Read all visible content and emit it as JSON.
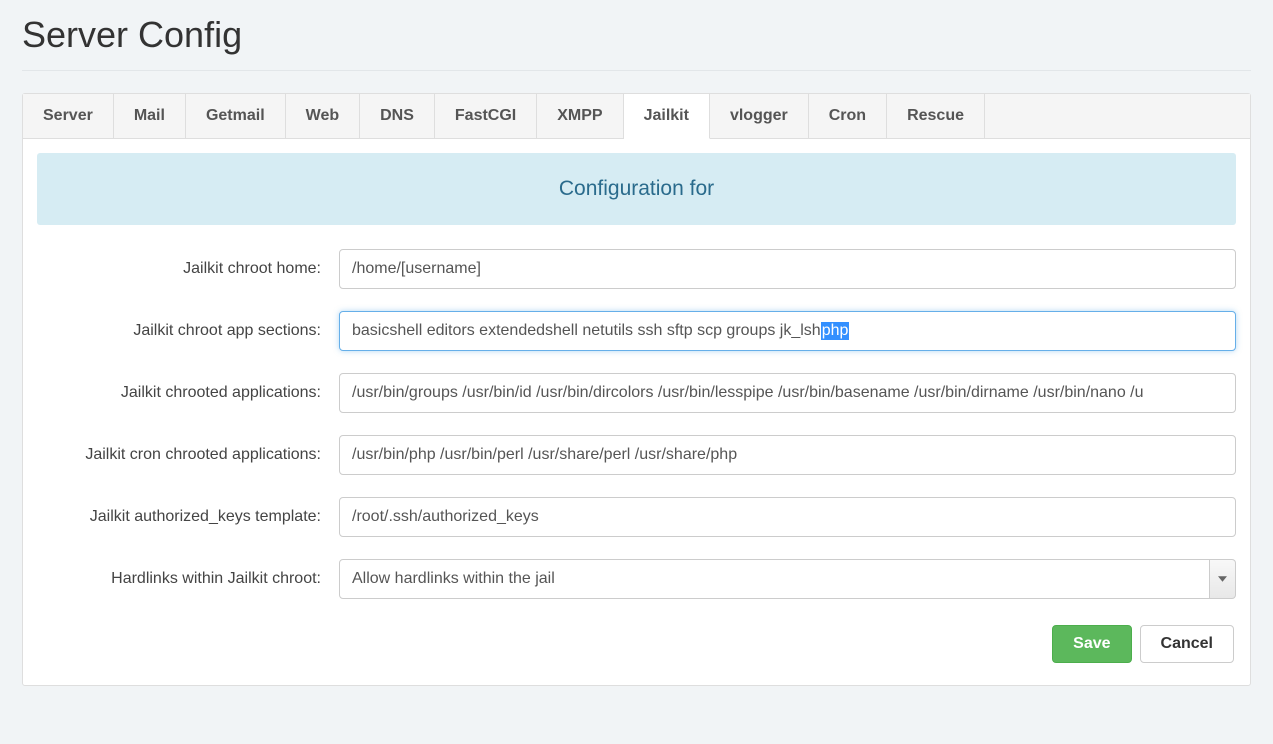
{
  "page": {
    "title": "Server Config"
  },
  "tabs": [
    {
      "label": "Server"
    },
    {
      "label": "Mail"
    },
    {
      "label": "Getmail"
    },
    {
      "label": "Web"
    },
    {
      "label": "DNS"
    },
    {
      "label": "FastCGI"
    },
    {
      "label": "XMPP"
    },
    {
      "label": "Jailkit",
      "active": true
    },
    {
      "label": "vlogger"
    },
    {
      "label": "Cron"
    },
    {
      "label": "Rescue"
    }
  ],
  "banner": {
    "text": "Configuration for"
  },
  "form": {
    "jailkit_chroot_home": {
      "label": "Jailkit chroot home:",
      "value": "/home/[username]"
    },
    "jailkit_chroot_app_sections": {
      "label": "Jailkit chroot app sections:",
      "value_prefix": "basicshell editors extendedshell netutils ssh sftp scp groups jk_lsh ",
      "value_selected": "php"
    },
    "jailkit_chrooted_applications": {
      "label": "Jailkit chrooted applications:",
      "value": "/usr/bin/groups /usr/bin/id /usr/bin/dircolors /usr/bin/lesspipe /usr/bin/basename /usr/bin/dirname /usr/bin/nano /u"
    },
    "jailkit_cron_chrooted_applications": {
      "label": "Jailkit cron chrooted applications:",
      "value": "/usr/bin/php /usr/bin/perl /usr/share/perl /usr/share/php"
    },
    "jailkit_authorized_keys_template": {
      "label": "Jailkit authorized_keys template:",
      "value": "/root/.ssh/authorized_keys"
    },
    "hardlinks_within_jailkit_chroot": {
      "label": "Hardlinks within Jailkit chroot:",
      "value": "Allow hardlinks within the jail"
    }
  },
  "actions": {
    "save": "Save",
    "cancel": "Cancel"
  }
}
